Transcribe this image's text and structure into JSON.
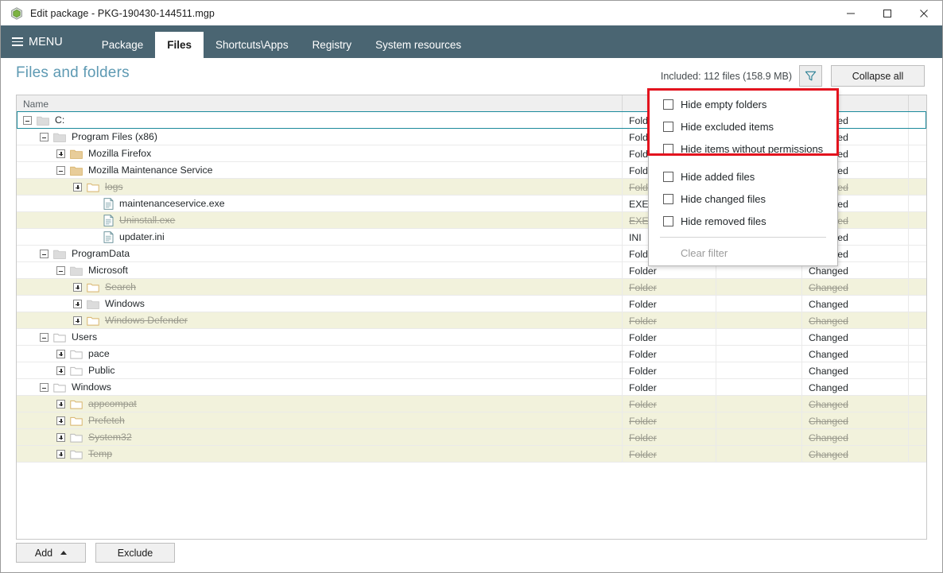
{
  "window": {
    "title": "Edit package - PKG-190430-144511.mgp",
    "app_icon": "package-icon",
    "controls": {
      "minimize": "minimize-icon",
      "maximize": "maximize-icon",
      "close": "close-icon"
    }
  },
  "ribbon": {
    "menu_label": "MENU",
    "tabs": [
      {
        "label": "Package",
        "active": false
      },
      {
        "label": "Files",
        "active": true
      },
      {
        "label": "Shortcuts\\Apps",
        "active": false
      },
      {
        "label": "Registry",
        "active": false
      },
      {
        "label": "System resources",
        "active": false
      }
    ]
  },
  "page": {
    "title": "Files and folders",
    "included_summary": "Included: 112 files (158.9 MB)",
    "filter_icon": "filter-funnel-icon",
    "collapse_all_label": "Collapse all"
  },
  "table": {
    "columns": [
      "Name",
      "",
      "",
      "",
      ""
    ],
    "rows": [
      {
        "indent": 0,
        "expander": "minus",
        "icon": "folder-gray-solid",
        "name": "C:",
        "type": "Folder",
        "extra": "",
        "status": "Changed",
        "excluded": false,
        "selected": true
      },
      {
        "indent": 1,
        "expander": "minus",
        "icon": "folder-gray-solid",
        "name": "Program Files (x86)",
        "type": "Folder",
        "extra": "",
        "status": "Changed",
        "excluded": false,
        "selected": false
      },
      {
        "indent": 2,
        "expander": "plus",
        "icon": "folder-tan-solid",
        "name": "Mozilla Firefox",
        "type": "Folder",
        "extra": "",
        "status": "Changed",
        "excluded": false,
        "selected": false
      },
      {
        "indent": 2,
        "expander": "minus",
        "icon": "folder-tan-solid",
        "name": "Mozilla Maintenance Service",
        "type": "Folder",
        "extra": "",
        "status": "Changed",
        "excluded": false,
        "selected": false
      },
      {
        "indent": 3,
        "expander": "plus",
        "icon": "folder-tan-open",
        "name": "logs",
        "type": "Folder",
        "extra": "",
        "status": "Changed",
        "excluded": true,
        "selected": false
      },
      {
        "indent": 4,
        "expander": "none",
        "icon": "file-icon",
        "name": "maintenanceservice.exe",
        "type": "EXE",
        "extra": "",
        "status": "Changed",
        "excluded": false,
        "selected": false
      },
      {
        "indent": 4,
        "expander": "none",
        "icon": "file-icon",
        "name": "Uninstall.exe",
        "type": "EXE",
        "extra": "",
        "status": "Changed",
        "excluded": true,
        "selected": false
      },
      {
        "indent": 4,
        "expander": "none",
        "icon": "file-icon",
        "name": "updater.ini",
        "type": "INI",
        "extra": "",
        "status": "Changed",
        "excluded": false,
        "selected": false
      },
      {
        "indent": 1,
        "expander": "minus",
        "icon": "folder-gray-solid",
        "name": "ProgramData",
        "type": "Folder",
        "extra": "",
        "status": "Changed",
        "excluded": false,
        "selected": false
      },
      {
        "indent": 2,
        "expander": "minus",
        "icon": "folder-gray-solid",
        "name": "Microsoft",
        "type": "Folder",
        "extra": "",
        "status": "Changed",
        "excluded": false,
        "selected": false
      },
      {
        "indent": 3,
        "expander": "plus",
        "icon": "folder-tan-open",
        "name": "Search",
        "type": "Folder",
        "extra": "",
        "status": "Changed",
        "excluded": true,
        "selected": false
      },
      {
        "indent": 3,
        "expander": "plus",
        "icon": "folder-gray-solid",
        "name": "Windows",
        "type": "Folder",
        "extra": "",
        "status": "Changed",
        "excluded": false,
        "selected": false
      },
      {
        "indent": 3,
        "expander": "plus",
        "icon": "folder-tan-open",
        "name": "Windows Defender",
        "type": "Folder",
        "extra": "",
        "status": "Changed",
        "excluded": true,
        "selected": false
      },
      {
        "indent": 1,
        "expander": "minus",
        "icon": "folder-gray-open",
        "name": "Users",
        "type": "Folder",
        "extra": "",
        "status": "Changed",
        "excluded": false,
        "selected": false
      },
      {
        "indent": 2,
        "expander": "plus",
        "icon": "folder-gray-open",
        "name": "pace",
        "type": "Folder",
        "extra": "",
        "status": "Changed",
        "excluded": false,
        "selected": false
      },
      {
        "indent": 2,
        "expander": "plus",
        "icon": "folder-gray-open",
        "name": "Public",
        "type": "Folder",
        "extra": "",
        "status": "Changed",
        "excluded": false,
        "selected": false
      },
      {
        "indent": 1,
        "expander": "minus",
        "icon": "folder-gray-open",
        "name": "Windows",
        "type": "Folder",
        "extra": "",
        "status": "Changed",
        "excluded": false,
        "selected": false
      },
      {
        "indent": 2,
        "expander": "plus",
        "icon": "folder-tan-open",
        "name": "appcompat",
        "type": "Folder",
        "extra": "",
        "status": "Changed",
        "excluded": true,
        "selected": false
      },
      {
        "indent": 2,
        "expander": "plus",
        "icon": "folder-tan-open",
        "name": "Prefetch",
        "type": "Folder",
        "extra": "",
        "status": "Changed",
        "excluded": true,
        "selected": false
      },
      {
        "indent": 2,
        "expander": "plus",
        "icon": "folder-gray-open",
        "name": "System32",
        "type": "Folder",
        "extra": "",
        "status": "Changed",
        "excluded": true,
        "selected": false
      },
      {
        "indent": 2,
        "expander": "plus",
        "icon": "folder-gray-open",
        "name": "Temp",
        "type": "Folder",
        "extra": "",
        "status": "Changed",
        "excluded": true,
        "selected": false
      }
    ]
  },
  "filter_menu": {
    "items": [
      {
        "label": "Hide empty folders",
        "checked": false,
        "disabled": false,
        "highlighted": true
      },
      {
        "label": "Hide excluded items",
        "checked": false,
        "disabled": false,
        "highlighted": true
      },
      {
        "label": "Hide items without permissions",
        "checked": false,
        "disabled": false,
        "highlighted": true
      },
      {
        "label": "Hide added files",
        "checked": false,
        "disabled": false,
        "highlighted": false
      },
      {
        "label": "Hide changed files",
        "checked": false,
        "disabled": false,
        "highlighted": false
      },
      {
        "label": "Hide removed files",
        "checked": false,
        "disabled": false,
        "highlighted": false
      }
    ],
    "clear_label": "Clear filter"
  },
  "footer": {
    "add_label": "Add",
    "exclude_label": "Exclude"
  },
  "colors": {
    "ribbon": "#4a6572",
    "heading": "#5e9ab3",
    "selection_border": "#1b8a9b",
    "excluded_row_bg": "#f2f2dc",
    "annotation_red": "#e3131e",
    "folder_tan": "#d8b36a",
    "folder_gray": "#c8c8c8"
  }
}
